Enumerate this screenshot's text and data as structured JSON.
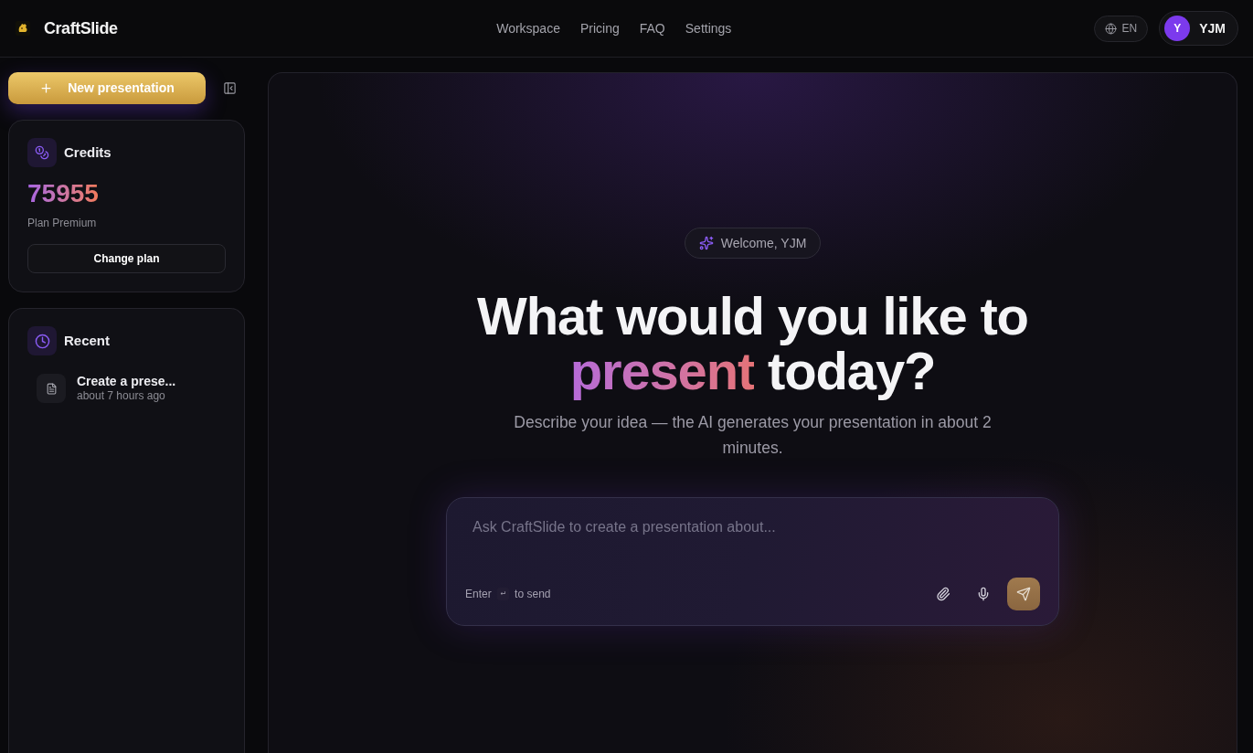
{
  "header": {
    "brand": "CraftSlide",
    "nav": [
      "Workspace",
      "Pricing",
      "FAQ",
      "Settings"
    ],
    "language": "EN",
    "user": {
      "initial": "Y",
      "name": "YJM"
    }
  },
  "sidebar": {
    "new_button": "New presentation",
    "credits": {
      "title": "Credits",
      "amount": "75955",
      "plan": "Plan Premium",
      "button": "Change plan"
    },
    "recent": {
      "title": "Recent",
      "items": [
        {
          "title": "Create a prese...",
          "time": "about 7 hours ago"
        }
      ]
    }
  },
  "main": {
    "welcome": "Welcome, YJM",
    "headline": {
      "before": "What would you like to",
      "highlight": "present",
      "after": "today?"
    },
    "description": "Describe your idea — the AI generates your presentation in about 2 minutes.",
    "prompt": {
      "placeholder": "Ask CraftSlide to create a presentation about...",
      "hint_before": "Enter",
      "hint_key": "↵",
      "hint_after": "to send"
    }
  }
}
